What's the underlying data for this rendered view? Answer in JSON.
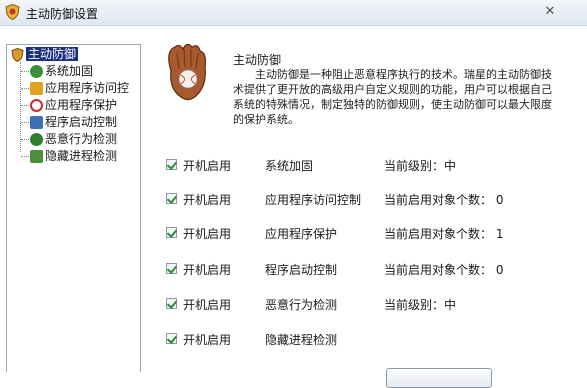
{
  "window": {
    "title": "主动防御设置",
    "close_glyph": "✕"
  },
  "tree": {
    "root_label": "主动防御",
    "items": [
      {
        "label": "系统加固",
        "icon": "globe-shield-icon",
        "color": "#3a8f3a"
      },
      {
        "label": "应用程序访问控",
        "icon": "folder-lock-icon",
        "color": "#e0a320"
      },
      {
        "label": "应用程序保护",
        "icon": "no-entry-icon",
        "color": "#cc2a2a"
      },
      {
        "label": "程序启动控制",
        "icon": "window-app-icon",
        "color": "#3d6fb5"
      },
      {
        "label": "恶意行为检测",
        "icon": "globe-check-icon",
        "color": "#2f7f2f"
      },
      {
        "label": "隐藏进程检测",
        "icon": "process-arrow-icon",
        "color": "#4b8f3c"
      }
    ]
  },
  "section": {
    "title": "主动防御",
    "description": "主动防御是一种阻止恶意程序执行的技术。瑞星的主动防御技术提供了更开放的高级用户自定义规则的功能，用户可以根据自己系统的特殊情况，制定独特的防御规则，使主动防御可以最大限度的保护系统。"
  },
  "features": [
    {
      "enable_label": "开机启用",
      "name": "系统加固",
      "status": "当前级别：中",
      "checked": true
    },
    {
      "enable_label": "开机启用",
      "name": "应用程序访问控制",
      "status": "当前启用对象个数： 0",
      "checked": true
    },
    {
      "enable_label": "开机启用",
      "name": "应用程序保护",
      "status": "当前启用对象个数： 1",
      "checked": true
    },
    {
      "enable_label": "开机启用",
      "name": "程序启动控制",
      "status": "当前启用对象个数： 0",
      "checked": true
    },
    {
      "enable_label": "开机启用",
      "name": "恶意行为检测",
      "status": "当前级别：中",
      "checked": true
    },
    {
      "enable_label": "开机启用",
      "name": "隐藏进程检测",
      "status": "",
      "checked": true
    }
  ]
}
